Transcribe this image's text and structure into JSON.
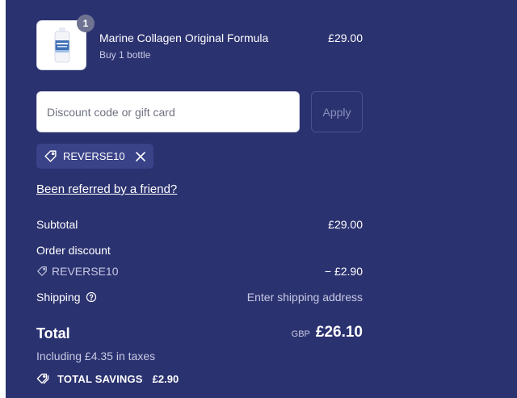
{
  "product": {
    "quantity": "1",
    "name": "Marine Collagen Original Formula",
    "variant": "Buy 1 bottle",
    "price": "£29.00",
    "thumbnail_icon": "collagen-bottle-image"
  },
  "discount": {
    "placeholder": "Discount code or gift card",
    "value": "",
    "apply_label": "Apply",
    "applied_code": "REVERSE10"
  },
  "referral": {
    "link_text": "Been referred by a friend?"
  },
  "summary": {
    "subtotal_label": "Subtotal",
    "subtotal_value": "£29.00",
    "order_discount_label": "Order discount",
    "discount_code": "REVERSE10",
    "discount_amount": "− £2.90",
    "shipping_label": "Shipping",
    "shipping_value": "Enter shipping address",
    "total_label": "Total",
    "currency": "GBP",
    "total_value": "£26.10",
    "tax_note": "Including £4.35 in taxes",
    "savings_label": "TOTAL SAVINGS",
    "savings_amount": "£2.90"
  },
  "colors": {
    "panel_bg": "#2b3270",
    "chip_bg": "#3a4288",
    "muted_text": "#c6c9e3"
  }
}
